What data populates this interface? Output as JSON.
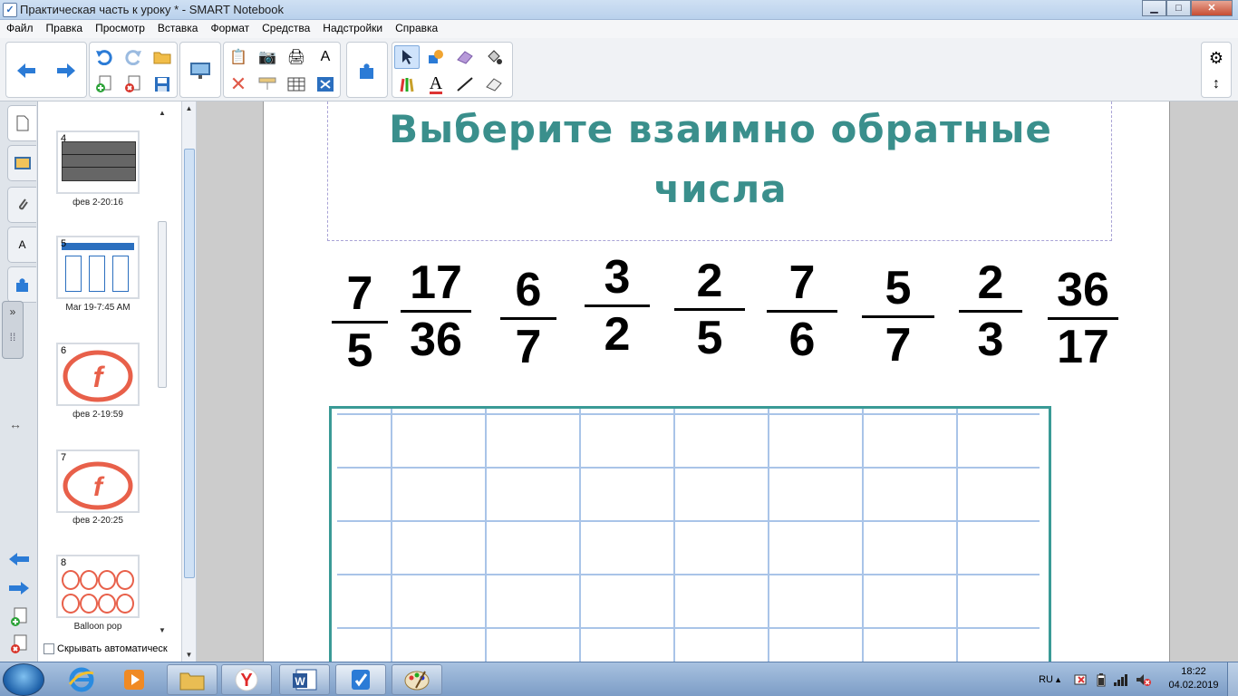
{
  "window": {
    "title": "Практическая часть к уроку * - SMART Notebook",
    "minimize": "▁",
    "maximize": "□",
    "close": "✕"
  },
  "menu": [
    "Файл",
    "Правка",
    "Просмотр",
    "Вставка",
    "Формат",
    "Средства",
    "Надстройки",
    "Справка"
  ],
  "toolbar": {
    "groups": [
      {
        "id": "navigation",
        "icons": [
          "back-arrow-icon",
          "forward-arrow-icon"
        ]
      },
      {
        "id": "file",
        "icons": [
          "undo-icon",
          "redo-icon",
          "open-folder-icon",
          "add-page-icon",
          "delete-page-icon",
          "save-icon"
        ]
      },
      {
        "id": "view",
        "icons": [
          "screen-display-icon"
        ]
      },
      {
        "id": "edit",
        "icons": [
          "paste-icon",
          "screenshot-camera-icon",
          "document-camera-icon",
          "spell-check-icon",
          "delete-x-icon",
          "screen-shade-icon",
          "table-icon",
          "fit-screen-icon"
        ]
      },
      {
        "id": "addons",
        "icons": [
          "puzzle-piece-icon"
        ]
      },
      {
        "id": "tools",
        "icons": [
          "select-pointer-icon",
          "shapes-icon",
          "eraser-icon",
          "fill-icon",
          "pens-icon",
          "text-icon",
          "line-icon",
          "magic-eraser-icon"
        ],
        "selected": "select-pointer-icon"
      }
    ],
    "right": [
      "gear-icon",
      "move-toolbar-icon"
    ]
  },
  "sidetabs": [
    "page-sorter-icon",
    "gallery-icon",
    "attachments-icon",
    "properties-icon",
    "addons-icon"
  ],
  "sorter": {
    "pages": [
      {
        "number": "4",
        "label": "фев 2-20:16"
      },
      {
        "number": "5",
        "label": "Mar 19-7:45 AM"
      },
      {
        "number": "6",
        "label": "фев 2-19:59"
      },
      {
        "number": "7",
        "label": "фев 2-20:25"
      },
      {
        "number": "8",
        "label": "Balloon pop"
      }
    ],
    "autohide_label": "Скрывать автоматическ"
  },
  "slide": {
    "heading_line1": "Выберите взаимно обратные",
    "heading_line2": "числа",
    "fractions": [
      {
        "num": "7",
        "den": "5"
      },
      {
        "num": "17",
        "den": "36"
      },
      {
        "num": "6",
        "den": "7"
      },
      {
        "num": "3",
        "den": "2"
      },
      {
        "num": "2",
        "den": "5"
      },
      {
        "num": "7",
        "den": "6"
      },
      {
        "num": "5",
        "den": "7"
      },
      {
        "num": "2",
        "den": "3"
      },
      {
        "num": "36",
        "den": "17"
      }
    ],
    "grid": {
      "columns": 8,
      "rows": 5,
      "line_color": "#a9c4e8",
      "border_color": "#3a9a96"
    }
  },
  "taskbar": {
    "apps": [
      "internet-explorer-icon",
      "media-player-icon",
      "file-explorer-icon",
      "yandex-browser-icon",
      "word-icon",
      "smart-notebook-icon",
      "paint-icon"
    ],
    "language": "RU",
    "time": "18:22",
    "date": "04.02.2019"
  },
  "colors": {
    "heading": "#3a8f8c",
    "accent": "#2f6fbf"
  }
}
